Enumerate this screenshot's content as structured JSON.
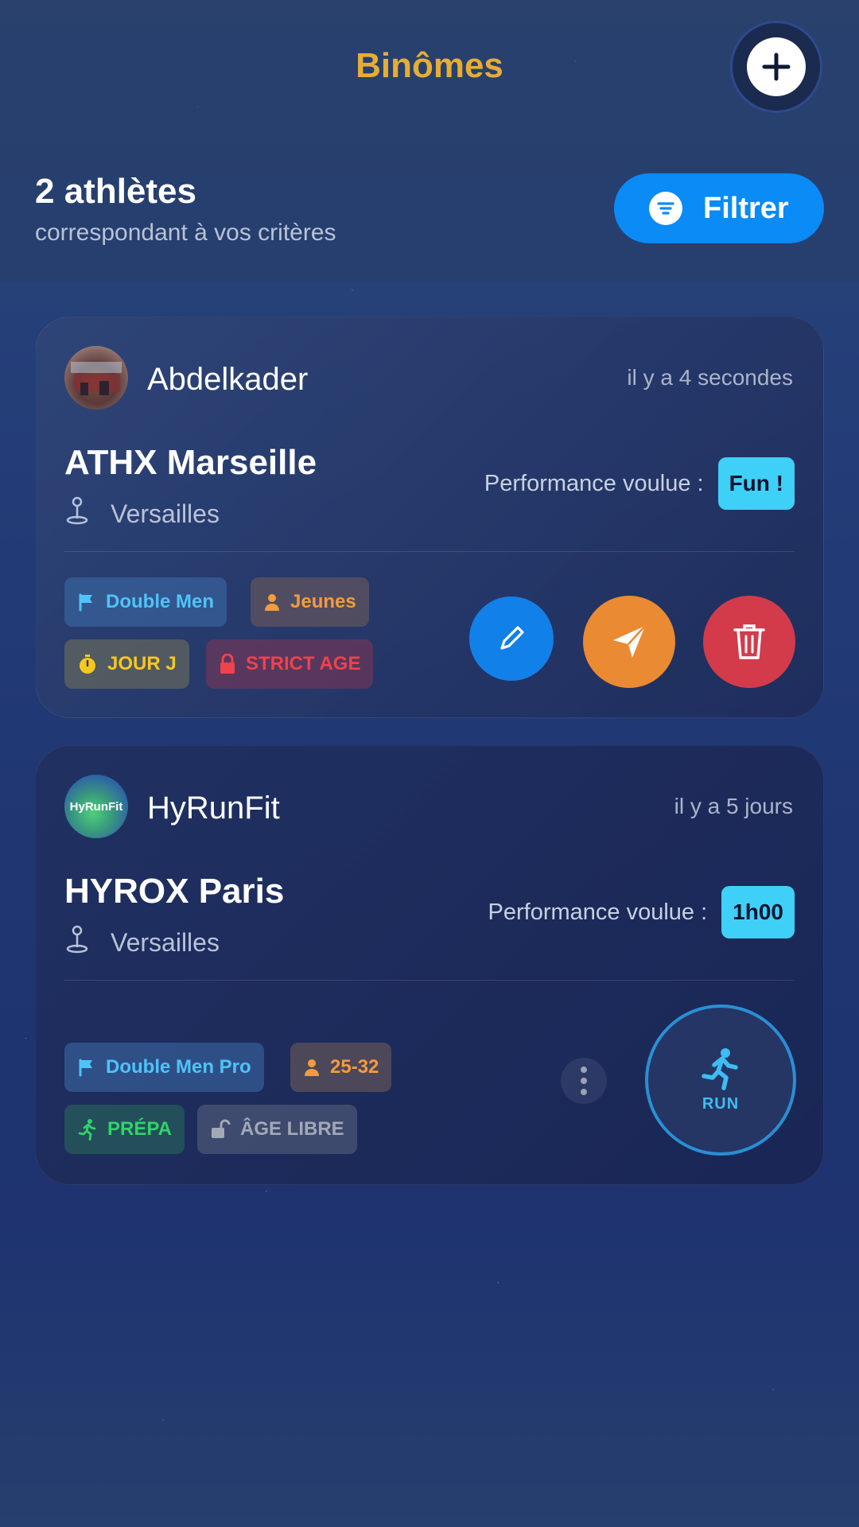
{
  "header": {
    "title": "Binômes",
    "count": "2 athlètes",
    "count_sub": "correspondant à vos critères",
    "filter_label": "Filtrer"
  },
  "cards": [
    {
      "user": "Abdelkader",
      "time": "il y a 4 secondes",
      "event": "ATHX Marseille",
      "location": "Versailles",
      "perf_label": "Performance voulue :",
      "perf_value": "Fun !",
      "tags": [
        "Double Men",
        "Jeunes",
        "JOUR J",
        "STRICT AGE"
      ]
    },
    {
      "user": "HyRunFit",
      "avatar_text": "HyRunFit",
      "time": "il y a 5 jours",
      "event": "HYROX Paris",
      "location": "Versailles",
      "perf_label": "Performance voulue :",
      "perf_value": "1h00",
      "tags": [
        "Double Men Pro",
        "25-32",
        "PRÉPA",
        "ÂGE LIBRE"
      ],
      "run_label": "RUN"
    }
  ],
  "colors": {
    "title": "#e6ad35",
    "filter": "#0a8bf5",
    "perf_badge": "#3fd0f7",
    "edit": "#1180e8",
    "send": "#ea8a33",
    "delete": "#d33b4b"
  },
  "icons": {
    "add": "plus-icon",
    "filter": "filter-icon",
    "location": "location-pin-icon",
    "flag": "flag-icon",
    "person": "person-icon",
    "timer": "stopwatch-icon",
    "lock": "lock-icon",
    "unlock": "unlock-icon",
    "runner": "runner-icon",
    "edit": "pencil-icon",
    "send": "send-icon",
    "delete": "trash-icon",
    "more": "more-vertical-icon"
  }
}
